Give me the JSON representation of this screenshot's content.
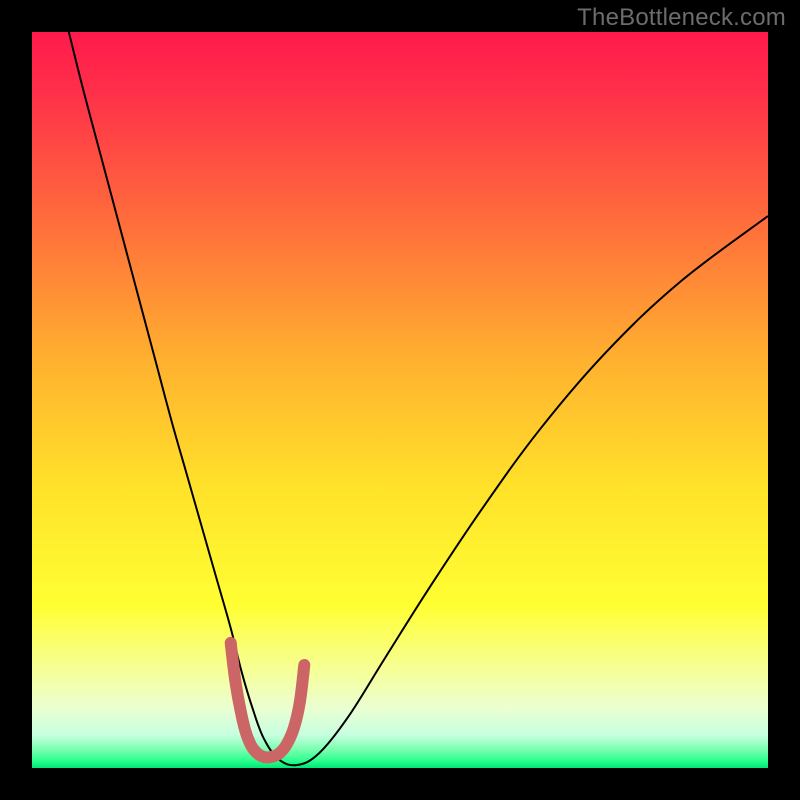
{
  "watermark": "TheBottleneck.com",
  "chart_data": {
    "type": "line",
    "title": "",
    "xlabel": "",
    "ylabel": "",
    "xlim": [
      0,
      100
    ],
    "ylim": [
      0,
      100
    ],
    "grid": false,
    "legend": false,
    "annotations": [],
    "gradient_stops": [
      {
        "pos": 0.0,
        "color": "#ff1a4b"
      },
      {
        "pos": 0.08,
        "color": "#ff2f4a"
      },
      {
        "pos": 0.25,
        "color": "#ff6a3c"
      },
      {
        "pos": 0.45,
        "color": "#ffb22f"
      },
      {
        "pos": 0.62,
        "color": "#ffe22a"
      },
      {
        "pos": 0.78,
        "color": "#ffff33"
      },
      {
        "pos": 0.86,
        "color": "#f7ff8f"
      },
      {
        "pos": 0.92,
        "color": "#eaffd2"
      },
      {
        "pos": 0.955,
        "color": "#c7ffdf"
      },
      {
        "pos": 0.975,
        "color": "#7affb0"
      },
      {
        "pos": 0.99,
        "color": "#2bff8e"
      },
      {
        "pos": 1.0,
        "color": "#00e676"
      }
    ],
    "series": [
      {
        "name": "bottleneck-curve",
        "color": "#000000",
        "stroke_width": 2,
        "x": [
          5,
          7,
          9,
          11,
          13,
          15,
          17,
          19,
          21,
          23,
          25,
          27,
          28.5,
          30,
          31.5,
          33.5,
          36,
          39,
          43,
          48,
          54,
          61,
          69,
          78,
          88,
          100
        ],
        "y": [
          100,
          92,
          84.5,
          77,
          69.5,
          62,
          54.5,
          47,
          40,
          33,
          26,
          19,
          13,
          8,
          4,
          1.2,
          0.4,
          2,
          7,
          15,
          24.5,
          35,
          46,
          56.5,
          66,
          75
        ]
      },
      {
        "name": "sweet-spot-marker",
        "color": "#cc6666",
        "stroke_width": 12,
        "linecap": "round",
        "x": [
          27.0,
          27.6,
          28.3,
          29.0,
          29.8,
          30.6,
          31.5,
          32.5,
          33.6,
          34.6,
          35.6,
          36.4,
          37.0
        ],
        "y": [
          17.0,
          12.0,
          8.0,
          5.0,
          3.0,
          2.0,
          1.5,
          1.5,
          2.0,
          3.2,
          5.5,
          9.0,
          14.0
        ]
      }
    ]
  }
}
